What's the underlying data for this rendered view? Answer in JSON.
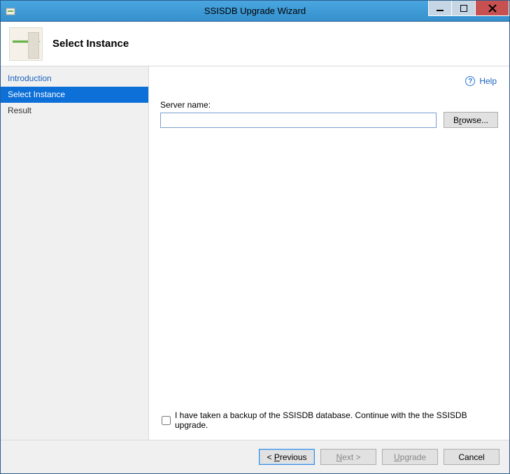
{
  "window": {
    "title": "SSISDB Upgrade Wizard"
  },
  "header": {
    "title": "Select Instance"
  },
  "sidebar": {
    "items": [
      {
        "label": "Introduction",
        "selected": false,
        "link": true
      },
      {
        "label": "Select Instance",
        "selected": true,
        "link": false
      },
      {
        "label": "Result",
        "selected": false,
        "link": false
      }
    ]
  },
  "help": {
    "label": "Help"
  },
  "content": {
    "server_name_label": "Server name:",
    "server_name_value": "",
    "browse_label_pre": "B",
    "browse_label_und": "r",
    "browse_label_post": "owse...",
    "checkbox_checked": false,
    "checkbox_label": "I have taken a backup of the SSISDB database.  Continue with the the SSISDB upgrade."
  },
  "footer": {
    "previous_pre": "< ",
    "previous_und": "P",
    "previous_post": "revious",
    "next_und": "N",
    "next_post": "ext >",
    "upgrade_und": "U",
    "upgrade_post": "pgrade",
    "cancel_label": "Cancel"
  }
}
